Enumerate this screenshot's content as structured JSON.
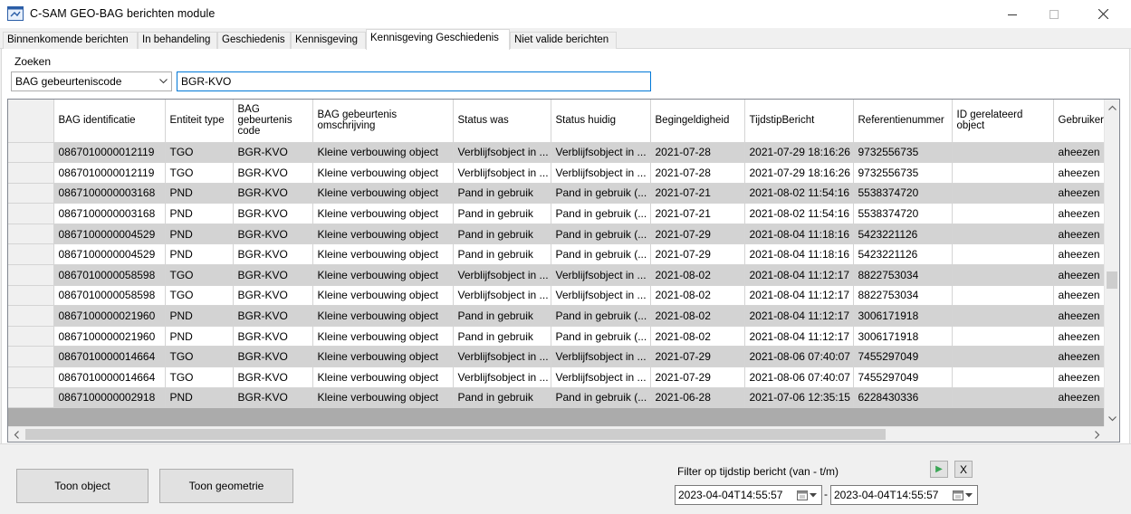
{
  "window": {
    "title": "C-SAM GEO-BAG berichten module"
  },
  "tabs": [
    {
      "label": "Binnenkomende berichten"
    },
    {
      "label": "In behandeling"
    },
    {
      "label": "Geschiedenis"
    },
    {
      "label": "Kennisgeving"
    },
    {
      "label": "Kennisgeving Geschiedenis"
    },
    {
      "label": "Niet valide berichten"
    }
  ],
  "active_tab": "Kennisgeving Geschiedenis",
  "search": {
    "label": "Zoeken",
    "field_selected": "BAG gebeurteniscode",
    "value": "BGR-KVO"
  },
  "grid": {
    "columns": [
      "BAG identificatie",
      "Entiteit type",
      "BAG gebeurtenis code",
      "BAG gebeurtenis omschrijving",
      "Status was",
      "Status huidig",
      "Begingeldigheid",
      "TijdstipBericht",
      "Referentienummer",
      "ID gerelateerd object",
      "Gebruiker"
    ],
    "rows": [
      [
        "0867010000012119",
        "TGO",
        "BGR-KVO",
        "Kleine verbouwing object",
        "Verblijfsobject in ...",
        "Verblijfsobject in ...",
        "2021-07-28",
        "2021-07-29 18:16:26",
        "9732556735",
        "",
        "aheezen"
      ],
      [
        "0867010000012119",
        "TGO",
        "BGR-KVO",
        "Kleine verbouwing object",
        "Verblijfsobject in ...",
        "Verblijfsobject in ...",
        "2021-07-28",
        "2021-07-29 18:16:26",
        "9732556735",
        "",
        "aheezen"
      ],
      [
        "0867100000003168",
        "PND",
        "BGR-KVO",
        "Kleine verbouwing object",
        "Pand in gebruik",
        "Pand in gebruik (...",
        "2021-07-21",
        "2021-08-02 11:54:16",
        "5538374720",
        "",
        "aheezen"
      ],
      [
        "0867100000003168",
        "PND",
        "BGR-KVO",
        "Kleine verbouwing object",
        "Pand in gebruik",
        "Pand in gebruik (...",
        "2021-07-21",
        "2021-08-02 11:54:16",
        "5538374720",
        "",
        "aheezen"
      ],
      [
        "0867100000004529",
        "PND",
        "BGR-KVO",
        "Kleine verbouwing object",
        "Pand in gebruik",
        "Pand in gebruik (...",
        "2021-07-29",
        "2021-08-04 11:18:16",
        "5423221126",
        "",
        "aheezen"
      ],
      [
        "0867100000004529",
        "PND",
        "BGR-KVO",
        "Kleine verbouwing object",
        "Pand in gebruik",
        "Pand in gebruik (...",
        "2021-07-29",
        "2021-08-04 11:18:16",
        "5423221126",
        "",
        "aheezen"
      ],
      [
        "0867010000058598",
        "TGO",
        "BGR-KVO",
        "Kleine verbouwing object",
        "Verblijfsobject in ...",
        "Verblijfsobject in ...",
        "2021-08-02",
        "2021-08-04 11:12:17",
        "8822753034",
        "",
        "aheezen"
      ],
      [
        "0867010000058598",
        "TGO",
        "BGR-KVO",
        "Kleine verbouwing object",
        "Verblijfsobject in ...",
        "Verblijfsobject in ...",
        "2021-08-02",
        "2021-08-04 11:12:17",
        "8822753034",
        "",
        "aheezen"
      ],
      [
        "0867100000021960",
        "PND",
        "BGR-KVO",
        "Kleine verbouwing object",
        "Pand in gebruik",
        "Pand in gebruik (...",
        "2021-08-02",
        "2021-08-04 11:12:17",
        "3006171918",
        "",
        "aheezen"
      ],
      [
        "0867100000021960",
        "PND",
        "BGR-KVO",
        "Kleine verbouwing object",
        "Pand in gebruik",
        "Pand in gebruik (...",
        "2021-08-02",
        "2021-08-04 11:12:17",
        "3006171918",
        "",
        "aheezen"
      ],
      [
        "0867010000014664",
        "TGO",
        "BGR-KVO",
        "Kleine verbouwing object",
        "Verblijfsobject in ...",
        "Verblijfsobject in ...",
        "2021-07-29",
        "2021-08-06 07:40:07",
        "7455297049",
        "",
        "aheezen"
      ],
      [
        "0867010000014664",
        "TGO",
        "BGR-KVO",
        "Kleine verbouwing object",
        "Verblijfsobject in ...",
        "Verblijfsobject in ...",
        "2021-07-29",
        "2021-08-06 07:40:07",
        "7455297049",
        "",
        "aheezen"
      ],
      [
        "0867100000002918",
        "PND",
        "BGR-KVO",
        "Kleine verbouwing object",
        "Pand in gebruik",
        "Pand in gebruik (...",
        "2021-06-28",
        "2021-07-06 12:35:15",
        "6228430336",
        "",
        "aheezen"
      ]
    ]
  },
  "buttons": {
    "show_object": "Toon object",
    "show_geometry": "Toon geometrie",
    "apply_filter": "▶",
    "clear_filter": "X"
  },
  "filter": {
    "label": "Filter op tijdstip bericht (van - t/m)",
    "from": "2023-04-04T14:55:57",
    "separator": "-",
    "to": "2023-04-04T14:55:57"
  },
  "colors": {
    "accent": "#0078d7",
    "alt_row": "#d3d3d3",
    "play_green": "#3aa655"
  },
  "icons": {
    "app": "app-window-icon",
    "minimize": "minimize-icon",
    "maximize": "maximize-icon",
    "close": "close-icon",
    "combo_arrow": "chevron-down-icon",
    "calendar": "calendar-icon"
  }
}
